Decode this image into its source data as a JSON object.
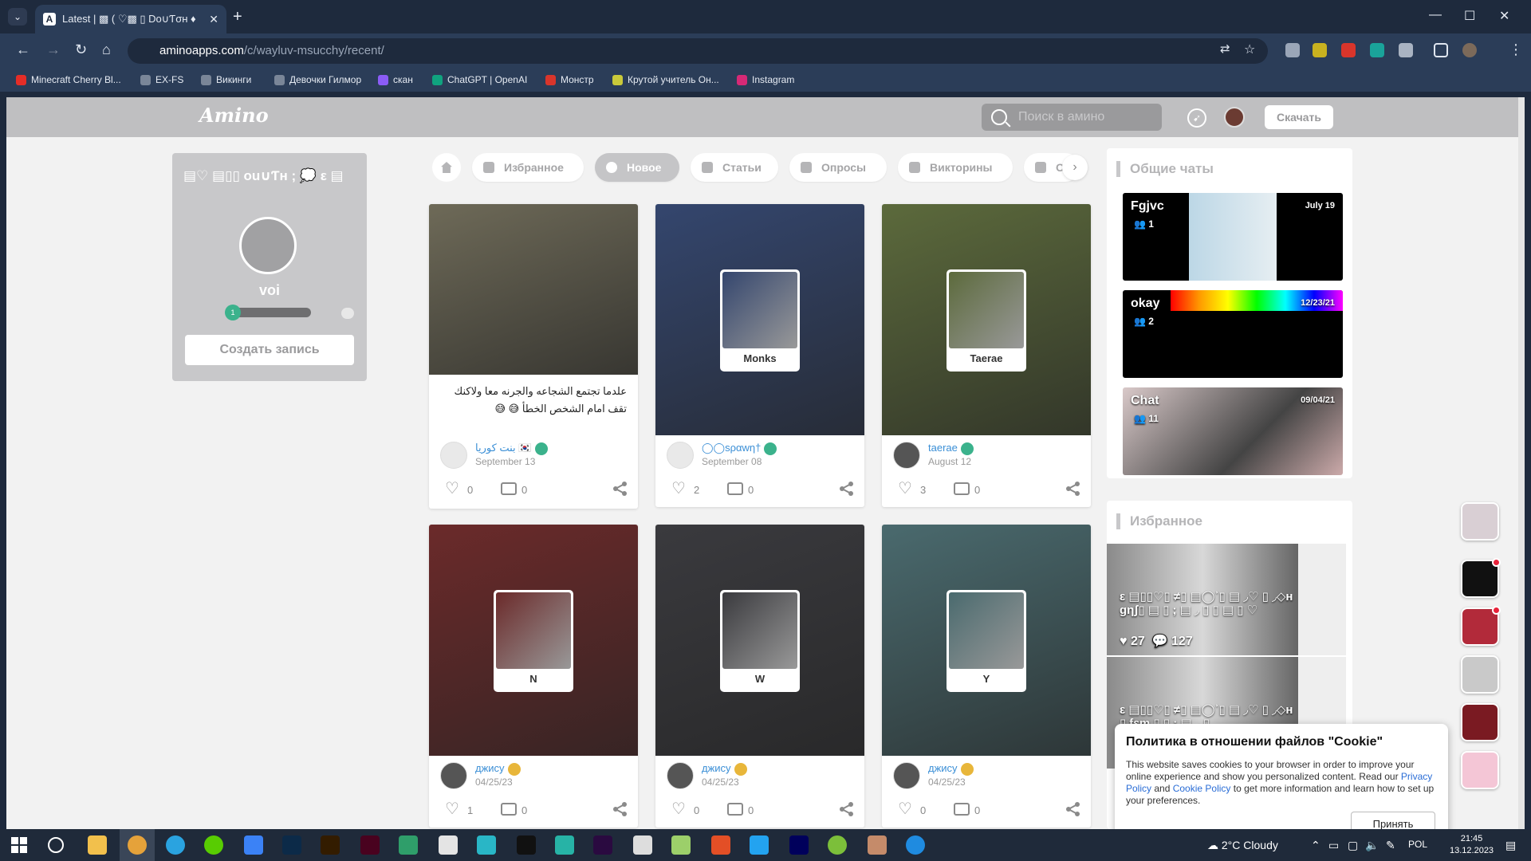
{
  "browser": {
    "tab_title": "Latest | ▩ ( ♡▩ ▯ Dо∪Ƭσʜ ♦",
    "url_domain": "aminoapps.com",
    "url_path": "/c/wayluv-msucchy/recent/",
    "bookmarks": [
      {
        "label": "Minecraft Cherry Bl...",
        "color": "#e52d27"
      },
      {
        "label": "EX-FS",
        "color": "#7a8698"
      },
      {
        "label": "Викинги",
        "color": "#7a8698"
      },
      {
        "label": "Девочки Гилмор",
        "color": "#7a8698"
      },
      {
        "label": "скан",
        "color": "#8b5cf6"
      },
      {
        "label": "ChatGPT | OpenAI",
        "color": "#10a37f"
      },
      {
        "label": "Монстр",
        "color": "#d9352b"
      },
      {
        "label": "Крутой учитель Он...",
        "color": "#c9c93a"
      },
      {
        "label": "Instagram",
        "color": "#d62976"
      }
    ]
  },
  "site": {
    "logo": "Amino",
    "search_placeholder": "Поиск в амино",
    "download_label": "Скачать"
  },
  "profile": {
    "title": "▤♡ ▤▯▯ оu∪Ƭʜ ; 💭 ε ▤",
    "name": "voi",
    "level": "1",
    "create_post_label": "Создать запись"
  },
  "filter_tabs": [
    "Избранное",
    "Новое",
    "Статьи",
    "Опросы",
    "Викторины",
    "О"
  ],
  "posts": [
    {
      "text": "علدما تجتمع الشجاعه والجرنه معا ولاكنك تقف امام الشخص الخطأ 😅 😅",
      "thumb_label": "",
      "author": "بنت كوريا 🇰🇷",
      "date": "September 13",
      "likes": "0",
      "comments": "0",
      "img": "#6e6a58"
    },
    {
      "text": "",
      "thumb_label": "Monks",
      "author": "◯◯ѕραwη†",
      "date": "September 08",
      "likes": "2",
      "comments": "0",
      "img": "#34466e"
    },
    {
      "text": "",
      "thumb_label": "Taerae",
      "author": "taerae",
      "date": "August 12",
      "likes": "3",
      "comments": "0",
      "img": "#5c6a3c"
    },
    {
      "text": "",
      "thumb_label": "N",
      "author": "джису",
      "date": "04/25/23",
      "likes": "1",
      "comments": "0",
      "img": "#6b2a2a"
    },
    {
      "text": "",
      "thumb_label": "W",
      "author": "джису",
      "date": "04/25/23",
      "likes": "0",
      "comments": "0",
      "img": "#3a3a3e"
    },
    {
      "text": "",
      "thumb_label": "Y",
      "author": "джису",
      "date": "04/25/23",
      "likes": "0",
      "comments": "0",
      "img": "#4a6a6e"
    }
  ],
  "chats": {
    "title": "Общие чаты",
    "items": [
      {
        "name": "Fgjvc",
        "date": "July 19",
        "members": "1"
      },
      {
        "name": "okay",
        "date": "12/23/21",
        "members": "2"
      },
      {
        "name": "Chat",
        "date": "09/04/21",
        "members": "11"
      }
    ]
  },
  "featured": {
    "title": "Избранное",
    "items": [
      {
        "text": "ε ▤▯▯♡▯ ≠▯ ▤◯ʾ▯ ▤ ◞♡ ▯ ◞◇ʜ ɡηʃ▯ ▤ ▯ ; ▤ ◞ ▯ ▯ ▤ ▯ ♡",
        "likes": "27",
        "comments": "127"
      },
      {
        "text": "ε ▤▯▯♡▯ ≠▯ ▤◯ʾ▯ ▤ ◞♡ ▯ ◞◇ʜ ▯ ƭɛm ▯ ▯ ; ▤ ◞ ▯",
        "likes": "",
        "comments": ""
      }
    ]
  },
  "cookie": {
    "title": "Политика в отношении файлов \"Cookie\"",
    "text_before": "This website saves cookies to your browser in order to improve your online experience and show you personalized content. Read our ",
    "privacy_link": "Privacy Policy",
    "and": " and ",
    "cookie_link": "Cookie Policy",
    "text_after": " to get more information and learn how to set up your preferences.",
    "accept_label": "Принять"
  },
  "taskbar": {
    "weather": "2°C  Cloudy",
    "lang": "POL",
    "time": "21:45",
    "date": "13.12.2023"
  },
  "colors": {
    "accent": "#3b8fd6",
    "header": "#bfbfc1",
    "level_badge": "#3bb28c"
  }
}
